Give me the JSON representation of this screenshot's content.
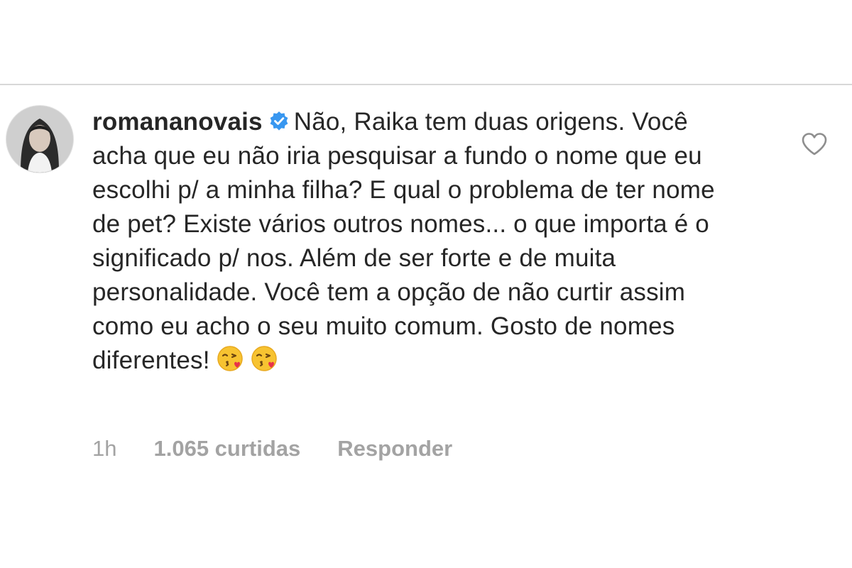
{
  "comment": {
    "username": "romananovais",
    "verified": true,
    "text": "Não, Raika tem duas origens. Você acha que eu não iria pesquisar a fundo o nome que eu escolhi p/ a minha filha? E qual o problema de ter nome de pet? Existe vários outros nomes... o que importa é o significado p/ nos. Além de ser forte e de muita personalidade. Você tem a opção de não curtir assim como eu acho o seu muito comum. Gosto de nomes diferentes!",
    "emojis": [
      "face-blowing-a-kiss-icon",
      "face-blowing-a-kiss-icon"
    ],
    "time": "1h",
    "likes": "1.065 curtidas",
    "reply_label": "Responder"
  },
  "colors": {
    "verified_blue": "#3897f0",
    "meta_gray": "#a3a3a3",
    "text": "#262626"
  },
  "icons": {
    "avatar": "profile-photo",
    "verified": "verified-badge-icon",
    "like": "heart-outline-icon"
  }
}
